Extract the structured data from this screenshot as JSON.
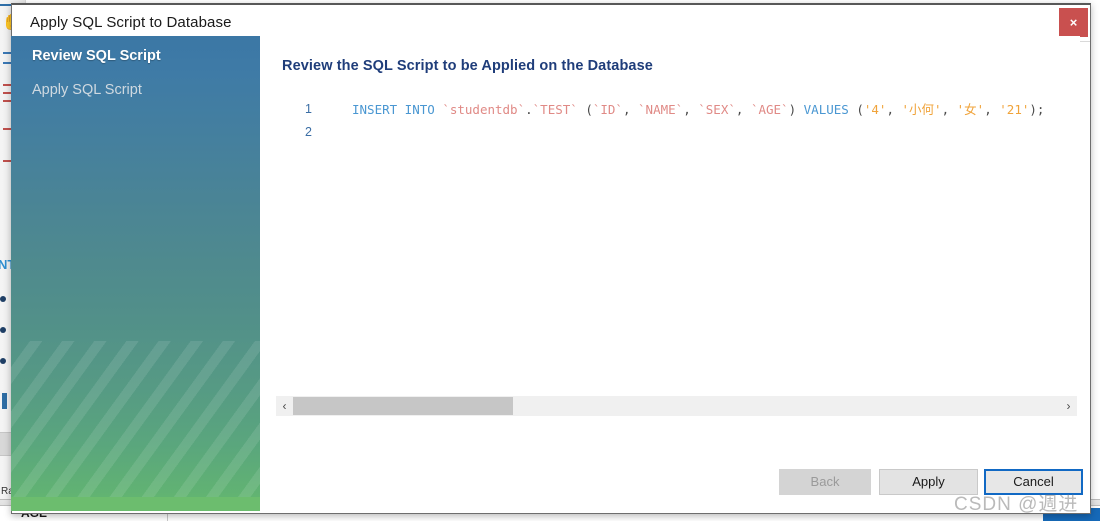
{
  "window": {
    "title": "Apply SQL Script to Database",
    "close_label": "×"
  },
  "sidebar": {
    "items": [
      {
        "label": "Review SQL Script",
        "state": "active"
      },
      {
        "label": "Apply SQL Script",
        "state": "disabled"
      }
    ]
  },
  "content": {
    "heading": "Review the SQL Script to be Applied on the Database",
    "code": {
      "lines": [
        {
          "number": "1",
          "tokens": [
            {
              "text": "INSERT INTO ",
              "type": "keyword"
            },
            {
              "text": "`studentdb`",
              "type": "identifier"
            },
            {
              "text": ".",
              "type": "punct"
            },
            {
              "text": "`TEST`",
              "type": "identifier"
            },
            {
              "text": " (",
              "type": "punct"
            },
            {
              "text": "`ID`",
              "type": "identifier"
            },
            {
              "text": ", ",
              "type": "punct"
            },
            {
              "text": "`NAME`",
              "type": "identifier"
            },
            {
              "text": ", ",
              "type": "punct"
            },
            {
              "text": "`SEX`",
              "type": "identifier"
            },
            {
              "text": ", ",
              "type": "punct"
            },
            {
              "text": "`AGE`",
              "type": "identifier"
            },
            {
              "text": ") ",
              "type": "punct"
            },
            {
              "text": "VALUES",
              "type": "keyword"
            },
            {
              "text": " (",
              "type": "punct"
            },
            {
              "text": "'4'",
              "type": "string"
            },
            {
              "text": ", ",
              "type": "punct"
            },
            {
              "text": "'小何'",
              "type": "string"
            },
            {
              "text": ", ",
              "type": "punct"
            },
            {
              "text": "'女'",
              "type": "string"
            },
            {
              "text": ", ",
              "type": "punct"
            },
            {
              "text": "'21'",
              "type": "string"
            },
            {
              "text": ");",
              "type": "punct"
            }
          ],
          "plain": "INSERT INTO `studentdb`.`TEST` (`ID`, `NAME`, `SEX`, `AGE`) VALUES ('4', '小何', '女', '21');"
        },
        {
          "number": "2",
          "tokens": [],
          "plain": ""
        }
      ]
    },
    "scrollbar": {
      "left_arrow": "‹",
      "right_arrow": "›"
    }
  },
  "buttons": {
    "back": "Back",
    "apply": "Apply",
    "cancel": "Cancel"
  },
  "watermark": "CSDN @週进",
  "background_app": {
    "fragment_text": "NT",
    "row_label": "Ra",
    "column_header": "AGE"
  },
  "colors": {
    "accent_blue": "#1169c4",
    "heading_navy": "#1f3d7a",
    "sidebar_top": "#3b77a5",
    "sidebar_bottom": "#66bb6f",
    "close_red": "#c9504f",
    "keyword": "#4a97d2",
    "identifier": "#e08a86",
    "string": "#f0a33a"
  }
}
